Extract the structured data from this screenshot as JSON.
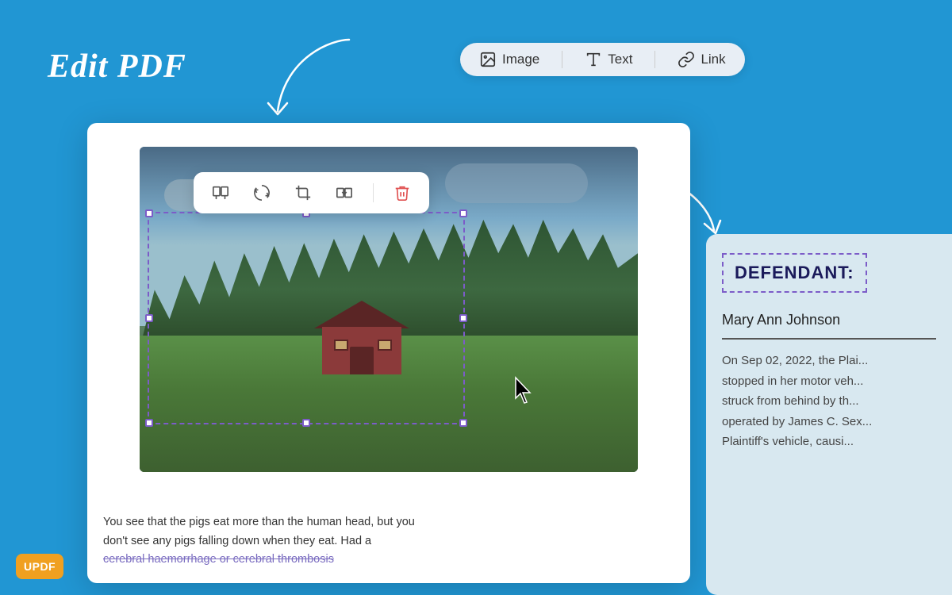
{
  "background_color": "#2196d3",
  "title": "Edit PDF",
  "toolbar": {
    "items": [
      {
        "id": "image",
        "label": "Image",
        "icon": "image-icon"
      },
      {
        "id": "text",
        "label": "Text",
        "icon": "text-icon"
      },
      {
        "id": "link",
        "label": "Link",
        "icon": "link-icon"
      }
    ]
  },
  "image_tools": [
    {
      "id": "replace",
      "icon": "replace-icon",
      "tooltip": "Replace"
    },
    {
      "id": "rotate",
      "icon": "rotate-icon",
      "tooltip": "Rotate"
    },
    {
      "id": "crop",
      "icon": "crop-icon",
      "tooltip": "Crop"
    },
    {
      "id": "extract",
      "icon": "extract-icon",
      "tooltip": "Extract"
    },
    {
      "id": "delete",
      "icon": "delete-icon",
      "tooltip": "Delete",
      "color": "red"
    }
  ],
  "pdf_text": {
    "line1": "You see that the pigs eat more than the human head, but you",
    "line2": "don't see any pigs falling down when they eat. Had a",
    "line3": "cerebral haemorrhage or cerebral thrombosis"
  },
  "legal_panel": {
    "label": "DEFENDANT:",
    "name": "Mary Ann Johnson",
    "body": "On Sep 02, 2022, the Plai... stopped in her motor veh... struck from behind by th... operated by James C. Sex... Plaintiff's vehicle, causi..."
  },
  "logo": {
    "text": "UPDF"
  }
}
